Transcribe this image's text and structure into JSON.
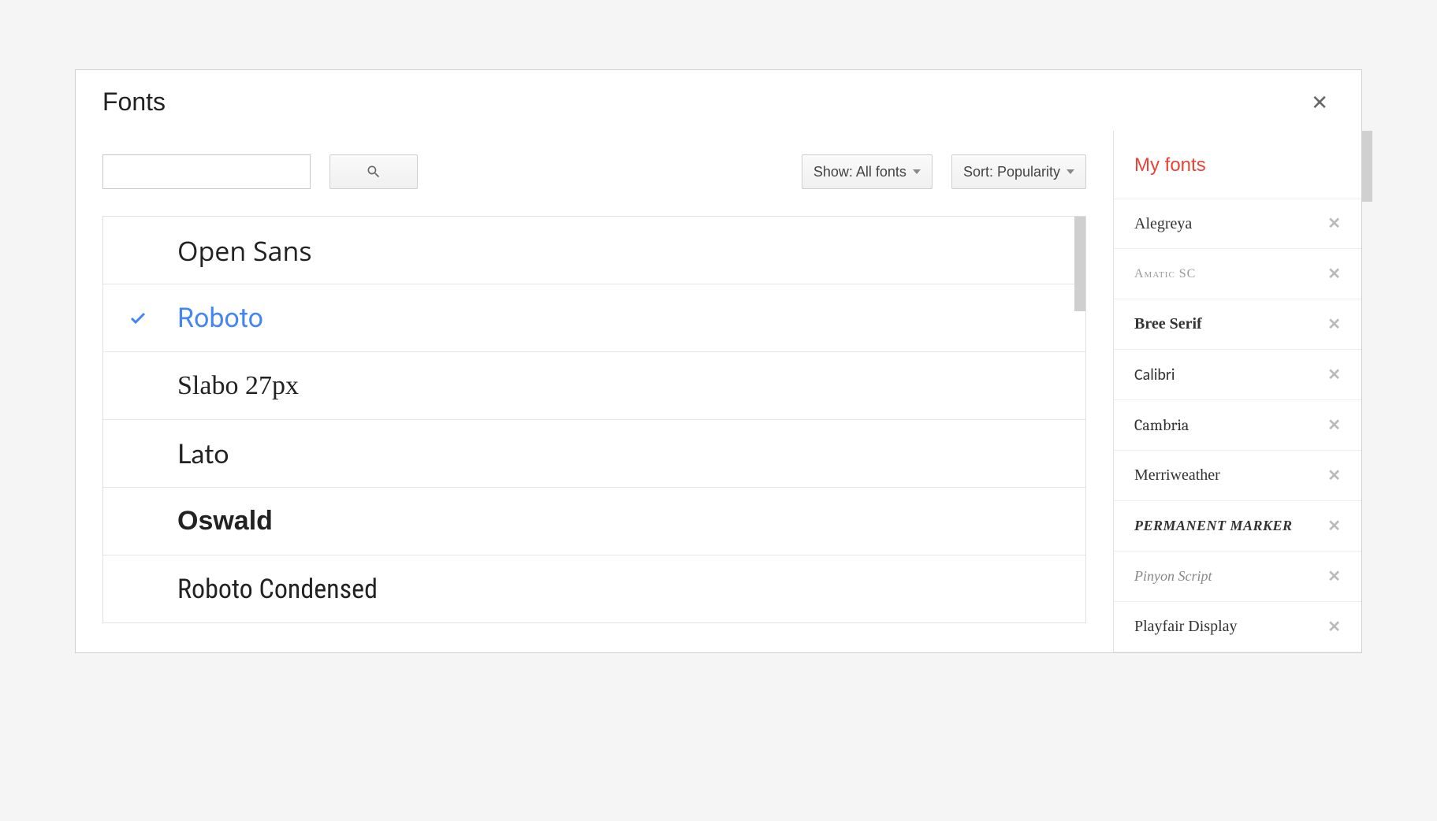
{
  "dialog": {
    "title": "Fonts"
  },
  "filters": {
    "show_label": "Show: All fonts",
    "sort_label": "Sort: Popularity"
  },
  "font_list": [
    {
      "name": "Open Sans",
      "selected": false,
      "css": "f-opensans"
    },
    {
      "name": "Roboto",
      "selected": true,
      "css": "f-roboto"
    },
    {
      "name": "Slabo 27px",
      "selected": false,
      "css": "f-slabo"
    },
    {
      "name": "Lato",
      "selected": false,
      "css": "f-lato"
    },
    {
      "name": "Oswald",
      "selected": false,
      "css": "f-oswald"
    },
    {
      "name": "Roboto Condensed",
      "selected": false,
      "css": "f-robotocond"
    }
  ],
  "sidebar": {
    "title": "My fonts",
    "items": [
      {
        "name": "Alegreya",
        "css": "f-alegreya"
      },
      {
        "name": "Amatic SC",
        "css": "f-amatic"
      },
      {
        "name": "Bree Serif",
        "css": "f-bree"
      },
      {
        "name": "Calibri",
        "css": "f-calibri"
      },
      {
        "name": "Cambria",
        "css": "f-cambria"
      },
      {
        "name": "Merriweather",
        "css": "f-merri"
      },
      {
        "name": "Permanent Marker",
        "css": "f-perm"
      },
      {
        "name": "Pinyon Script",
        "css": "f-pinyon"
      },
      {
        "name": "Playfair Display",
        "css": "f-playfair"
      }
    ]
  }
}
